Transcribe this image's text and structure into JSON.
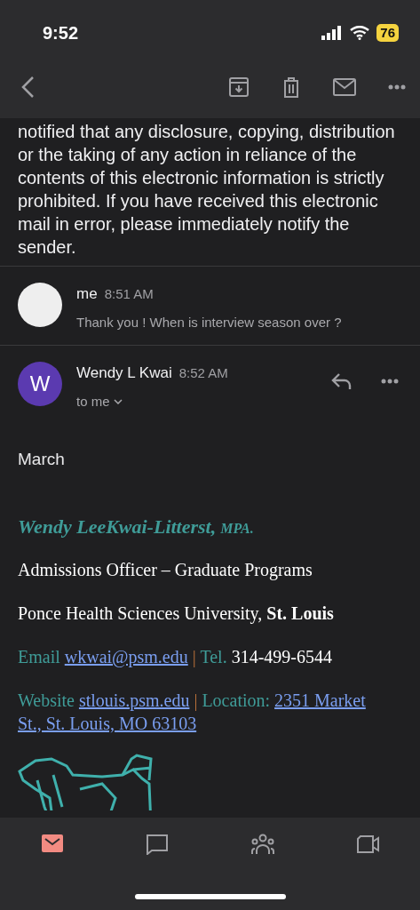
{
  "status_bar": {
    "time": "9:52",
    "battery": "76"
  },
  "toolbar": {
    "actions": [
      {
        "kind": "back"
      },
      {
        "kind": "archive"
      },
      {
        "kind": "delete"
      },
      {
        "kind": "mark-unread"
      },
      {
        "kind": "more"
      }
    ]
  },
  "previous_body": "notified that any disclosure, copying, distribution or the taking of any action in reliance of the contents of this electronic information is strictly prohibited. If you have received this electronic mail in error, please immediately notify the sender.",
  "messages": [
    {
      "sender": "me",
      "time": "8:51 AM",
      "snippet": "Thank you ! When is interview season over ?",
      "expanded": false,
      "avatar": {
        "kind": "photo"
      }
    },
    {
      "sender": "Wendy L Kwai",
      "time": "8:52 AM",
      "recipient": "to me",
      "expanded": true,
      "avatar": {
        "kind": "letter",
        "initial": "W",
        "color": "#5b3ab0"
      }
    }
  ],
  "body": "March",
  "signature": {
    "name": "Wendy LeeKwai-Litterst,",
    "suffix": "MPA.",
    "lines": [
      {
        "segments": [
          {
            "kind": "plain",
            "text": "Admissions Officer – Graduate Programs"
          }
        ]
      },
      {
        "segments": [
          {
            "kind": "plain",
            "text": "Ponce Health Sciences University, **St. Louis**"
          }
        ]
      },
      {
        "segments": [
          {
            "kind": "label",
            "text": "Email"
          },
          {
            "kind": "link",
            "text": "wkwai@psm.edu"
          },
          {
            "kind": "sep",
            "text": "|"
          },
          {
            "kind": "label",
            "text": "Tel."
          },
          {
            "kind": "plain",
            "text": "314-499-6544"
          }
        ]
      },
      {
        "segments": [
          {
            "kind": "label",
            "text": "Website"
          },
          {
            "kind": "link",
            "text": "stlouis.psm.edu"
          },
          {
            "kind": "sep",
            "text": "|"
          },
          {
            "kind": "label",
            "text": "Location:"
          },
          {
            "kind": "link",
            "text": "2351 Market"
          },
          {
            "kind": "link",
            "text": "St., St. Louis, MO 63103"
          }
        ]
      }
    ]
  },
  "bottom_nav": [
    {
      "kind": "mail",
      "selected": true
    },
    {
      "kind": "chat",
      "selected": false
    },
    {
      "kind": "spaces",
      "selected": false
    },
    {
      "kind": "meet",
      "selected": false
    }
  ]
}
